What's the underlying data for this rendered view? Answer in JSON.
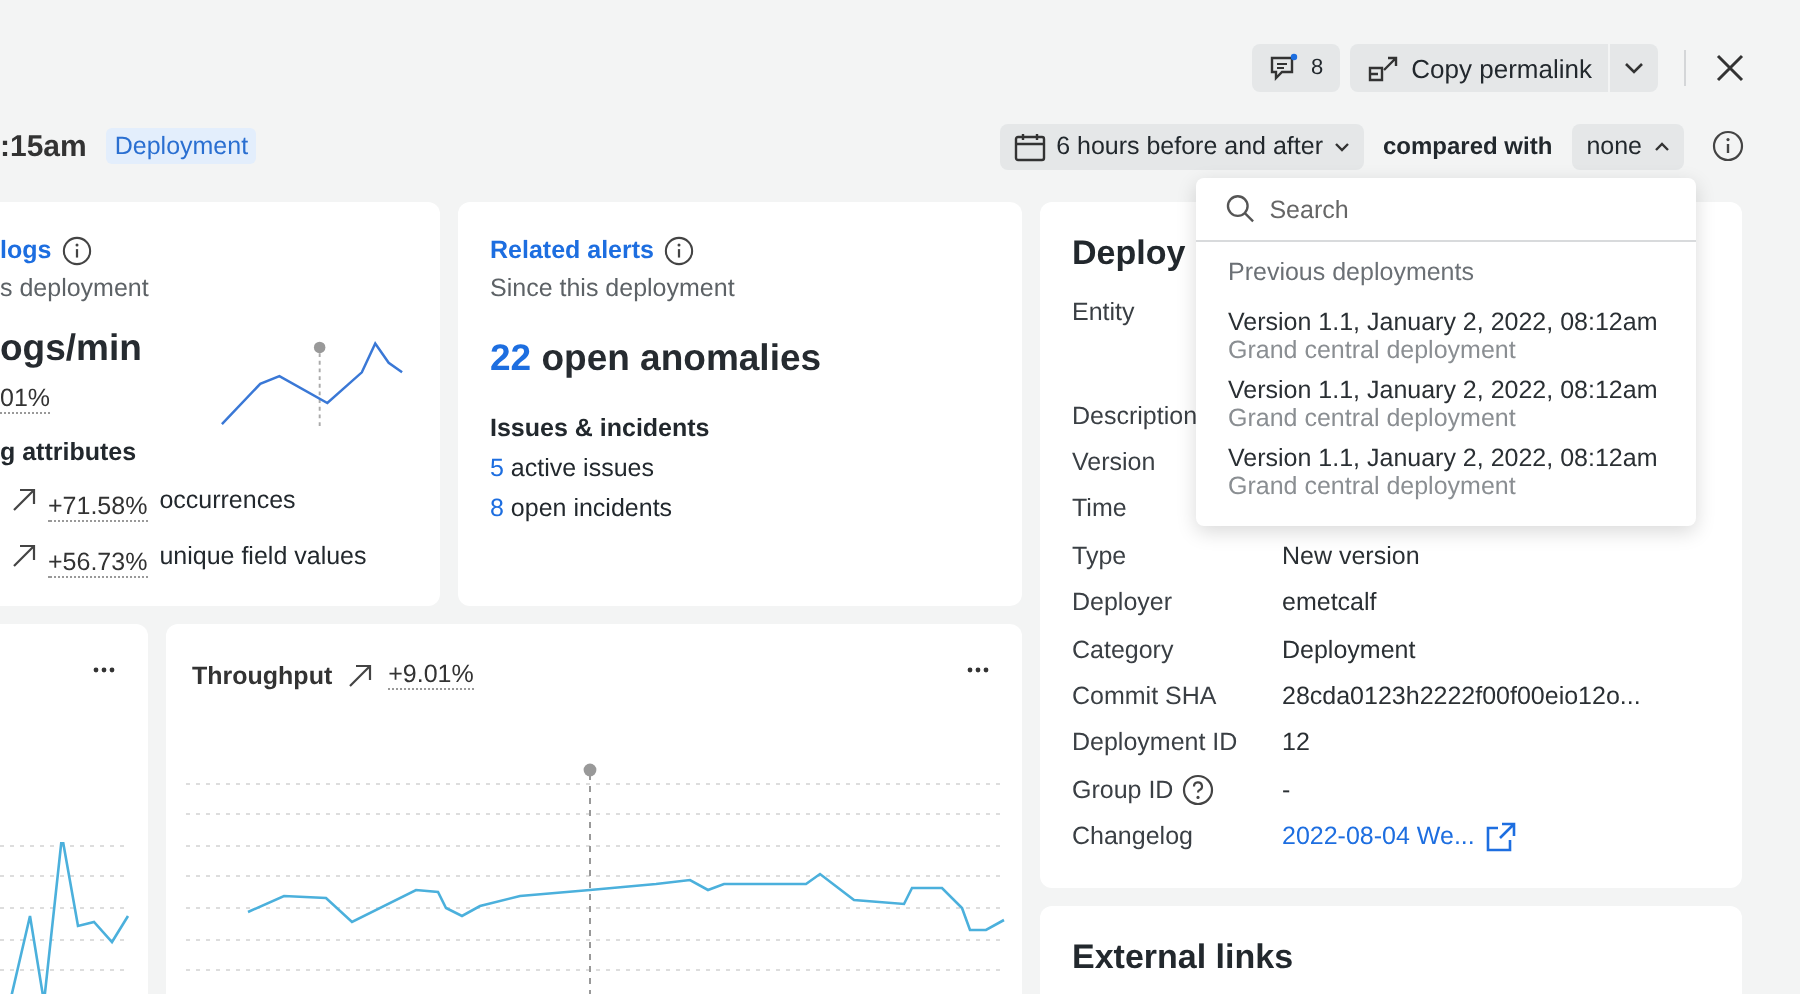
{
  "toolbar": {
    "comments_count": "8",
    "copy_button": "Copy permalink"
  },
  "header": {
    "time": ":15am",
    "badge": "Deployment",
    "range": "6 hours before and after",
    "compare_label": "compared with",
    "compare_value": "none",
    "compare_expanded": true
  },
  "logs_card": {
    "title": "logs",
    "subtitle": "s deployment",
    "metric": "ogs/min",
    "change": "01%",
    "attributes_title": "g attributes",
    "attributes": [
      {
        "value": "+71.58%",
        "label": "occurrences"
      },
      {
        "value": "+56.73%",
        "label": "unique field values"
      }
    ]
  },
  "alerts_card": {
    "title": "Related alerts",
    "subtitle": "Since this deployment",
    "count": "22",
    "count_label": "open anomalies",
    "section": "Issues & incidents",
    "items": [
      {
        "count": "5",
        "label": "active issues"
      },
      {
        "count": "8",
        "label": "open incidents"
      }
    ]
  },
  "throughput_card": {
    "title": "Throughput",
    "change": "+9.01%"
  },
  "details": {
    "title": "Deploy",
    "rows": [
      {
        "label": "Entity",
        "kind": "tall",
        "help": false
      },
      {
        "label": "Description",
        "kind": "text",
        "help": false
      },
      {
        "label": "Version",
        "kind": "text",
        "help": false
      },
      {
        "label": "Time",
        "kind": "text",
        "help": false
      },
      {
        "label": "Type",
        "kind": "text",
        "help": false,
        "value": "New version"
      },
      {
        "label": "Deployer",
        "kind": "text",
        "help": false,
        "value": "emetcalf"
      },
      {
        "label": "Category",
        "kind": "text",
        "help": false,
        "value": "Deployment"
      },
      {
        "label": "Commit SHA",
        "kind": "text",
        "help": false,
        "value": "28cda0123h2222f00f00eio12o..."
      },
      {
        "label": "Deployment ID",
        "kind": "text",
        "help": false,
        "value": "12"
      },
      {
        "label": "Group ID",
        "kind": "text",
        "help": true,
        "value": "-"
      },
      {
        "label": "Changelog",
        "kind": "link",
        "help": false,
        "value": "2022-08-04 We..."
      }
    ]
  },
  "external_links": {
    "title": "External links"
  },
  "dropdown": {
    "search": {
      "placeholder": "Search"
    },
    "section": "Previous deployments",
    "items": [
      {
        "title": "Version 1.1, January 2, 2022, 08:12am",
        "subtitle": "Grand central deployment"
      },
      {
        "title": "Version 1.1, January 2, 2022, 08:12am",
        "subtitle": "Grand central deployment"
      },
      {
        "title": "Version 1.1, January 2, 2022, 08:12am",
        "subtitle": "Grand central deployment"
      }
    ]
  }
}
